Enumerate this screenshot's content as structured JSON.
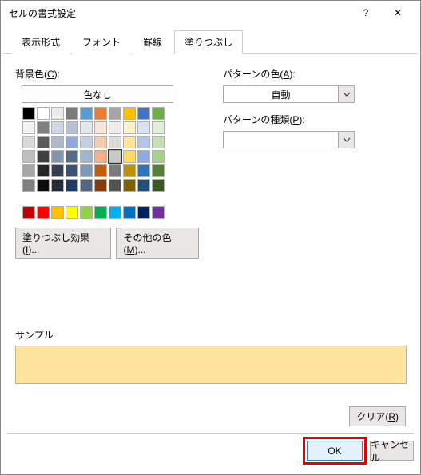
{
  "title": "セルの書式設定",
  "tabs": [
    "表示形式",
    "フォント",
    "罫線",
    "塗りつぶし"
  ],
  "active_tab": 3,
  "labels": {
    "bg": "背景色(C):",
    "nocolor": "色なし",
    "fill_effects": "塗りつぶし効果(I)...",
    "more_colors": "その他の色(M)...",
    "pattern_color": "パターンの色(A):",
    "pattern_color_val": "自動",
    "pattern_type": "パターンの種類(P):",
    "sample": "サンプル",
    "clear": "クリア(R)",
    "ok": "OK",
    "cancel": "キャンセル"
  },
  "selected_swatch": 36,
  "swatches_main": [
    "#000000",
    "#ffffff",
    "#ebebeb",
    "#7b7b7b",
    "#5b9bd5",
    "#ed7d31",
    "#a5a5a5",
    "#ffc000",
    "#4472c4",
    "#70ad47",
    "#f2f2f2",
    "#808080",
    "#d0d8e8",
    "#b5c0d1",
    "#e0e8f0",
    "#fbe5d6",
    "#ededed",
    "#fff2cc",
    "#d9e2f3",
    "#e2efd9",
    "#d9d9d9",
    "#595959",
    "#adb9ca",
    "#8eaadb",
    "#c2d0e0",
    "#f8cbad",
    "#dbdbdb",
    "#ffe599",
    "#b4c7e7",
    "#c5e0b4",
    "#bfbfbf",
    "#404040",
    "#8497b0",
    "#556b8c",
    "#a0b4cc",
    "#f4b183",
    "#c9c9c9",
    "#ffd966",
    "#8faadc",
    "#a9d18e",
    "#a6a6a6",
    "#262626",
    "#333f50",
    "#3b5175",
    "#7f98b7",
    "#c55a11",
    "#7b7b7b",
    "#bf9000",
    "#2e75b6",
    "#548235",
    "#7f7f7f",
    "#0d0d0d",
    "#222a35",
    "#203864",
    "#506683",
    "#843c0c",
    "#525252",
    "#7f6000",
    "#1f4e79",
    "#385723"
  ],
  "swatches_std": [
    "#c00000",
    "#ff0000",
    "#ffc000",
    "#ffff00",
    "#92d050",
    "#00b050",
    "#00b0f0",
    "#0070c0",
    "#002060",
    "#7030a0"
  ]
}
